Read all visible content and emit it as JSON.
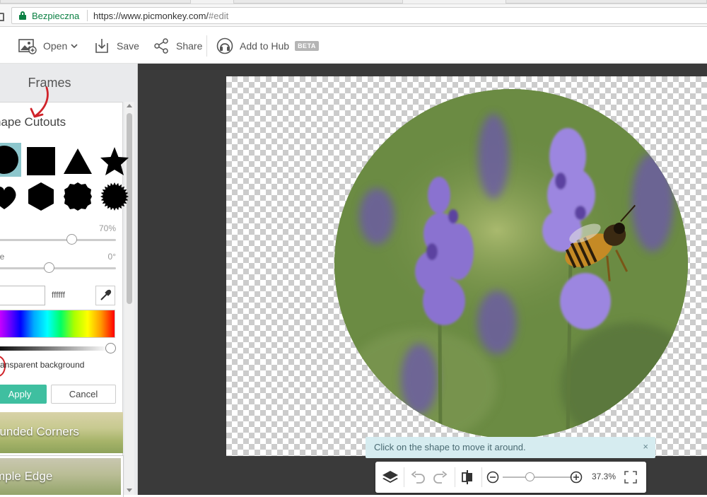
{
  "browser": {
    "secure_label": "Bezpieczna",
    "url_domain": "https://www.picmonkey.com/",
    "url_path": "#edit"
  },
  "toolbar": {
    "open_label": "Open",
    "save_label": "Save",
    "share_label": "Share",
    "hub_label": "Add to Hub",
    "beta_badge": "BETA"
  },
  "sidebar": {
    "title": "Frames",
    "section_title": "hape Cutouts",
    "shapes": [
      "circle",
      "square",
      "triangle",
      "star",
      "heart",
      "hexagon",
      "scalloped-circle",
      "seal"
    ],
    "opacity": {
      "value": "70%",
      "fraction": 0.7
    },
    "angle": {
      "label": "le",
      "value": "0°"
    },
    "color": {
      "hex": "ffffff"
    },
    "transparent_label": "ransparent background",
    "apply_label": "Apply",
    "cancel_label": "Cancel",
    "frames": [
      {
        "label": "ounded Corners"
      },
      {
        "label": "mple Edge"
      }
    ]
  },
  "canvas": {
    "tip_text": "Click on the shape to move it around.",
    "tip_close": "×",
    "zoom": "37.3%"
  }
}
